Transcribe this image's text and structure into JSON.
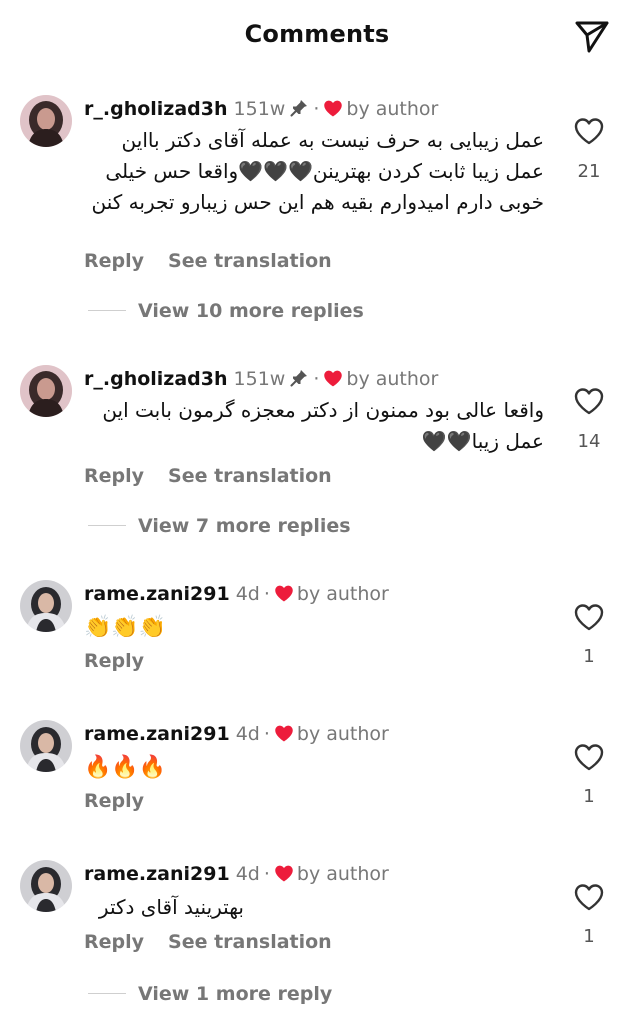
{
  "header": {
    "title": "Comments",
    "send_icon": "send-icon"
  },
  "colors": {
    "heart_red": "#ED1C3B",
    "meta_gray": "#777777",
    "text": "#111111"
  },
  "comments": [
    {
      "username": "r_.gholizad3h",
      "age": "151w",
      "pinned": true,
      "separator": "·",
      "liked_by": "by author",
      "text": "عمل زیبایی به حرف نیست به عمله آقای دکتر بااین عمل زیبا ثابت کردن بهترینن🖤🖤🖤واقعا حس خیلی خوبی دارم امیدوارم بقیه هم این حس زیبارو تجربه کنن",
      "reply_label": "Reply",
      "translate_label": "See translation",
      "likes": "21",
      "view_more": "View 10 more replies"
    },
    {
      "username": "r_.gholizad3h",
      "age": "151w",
      "pinned": true,
      "separator": "·",
      "liked_by": "by author",
      "text": "واقعا عالی بود ممنون از دکتر معجزه گرمون بابت این عمل زیبا🖤🖤",
      "reply_label": "Reply",
      "translate_label": "See translation",
      "likes": "14",
      "view_more": "View 7 more replies"
    },
    {
      "username": "rame.zani291",
      "age": "4d",
      "separator": "·",
      "liked_by": "by author",
      "text": "👏👏👏",
      "reply_label": "Reply",
      "likes": "1"
    },
    {
      "username": "rame.zani291",
      "age": "4d",
      "separator": "·",
      "liked_by": "by author",
      "text": "🔥🔥🔥",
      "reply_label": "Reply",
      "likes": "1"
    },
    {
      "username": "rame.zani291",
      "age": "4d",
      "separator": "·",
      "liked_by": "by author",
      "text": "بهترینید آقای دکتر",
      "reply_label": "Reply",
      "translate_label": "See translation",
      "likes": "1",
      "view_more": "View 1 more reply"
    }
  ]
}
